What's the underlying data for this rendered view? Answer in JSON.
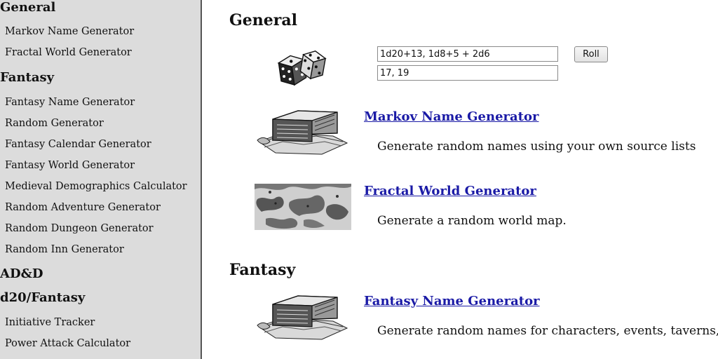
{
  "sidebar": {
    "sections": [
      {
        "heading": "General",
        "items": [
          "Markov Name Generator",
          "Fractal World Generator"
        ]
      },
      {
        "heading": "Fantasy",
        "items": [
          "Fantasy Name Generator",
          "Random Generator",
          "Fantasy Calendar Generator",
          "Fantasy World Generator",
          "Medieval Demographics Calculator",
          "Random Adventure Generator",
          "Random Dungeon Generator",
          "Random Inn Generator"
        ]
      },
      {
        "heading": "AD&D",
        "items": []
      },
      {
        "heading": "d20/Fantasy",
        "items": [
          "Initiative Tracker",
          "Power Attack Calculator"
        ]
      }
    ]
  },
  "main": {
    "sections": [
      {
        "title": "General"
      },
      {
        "title": "Fantasy"
      }
    ],
    "dice_roller": {
      "expression_value": "1d20+13, 1d8+5 + 2d6",
      "result_value": "17, 19",
      "roll_label": "Roll",
      "icon": "dice-icon"
    },
    "generators": [
      {
        "title": "Markov Name Generator",
        "description": "Generate random names using your own source lists",
        "icon": "book-scroll-icon"
      },
      {
        "title": "Fractal World Generator",
        "description": "Generate a random world map.",
        "icon": "world-map-icon"
      },
      {
        "title": "Fantasy Name Generator",
        "description": "Generate random names for characters, events, taverns, etc",
        "icon": "book-scroll-icon"
      }
    ]
  }
}
